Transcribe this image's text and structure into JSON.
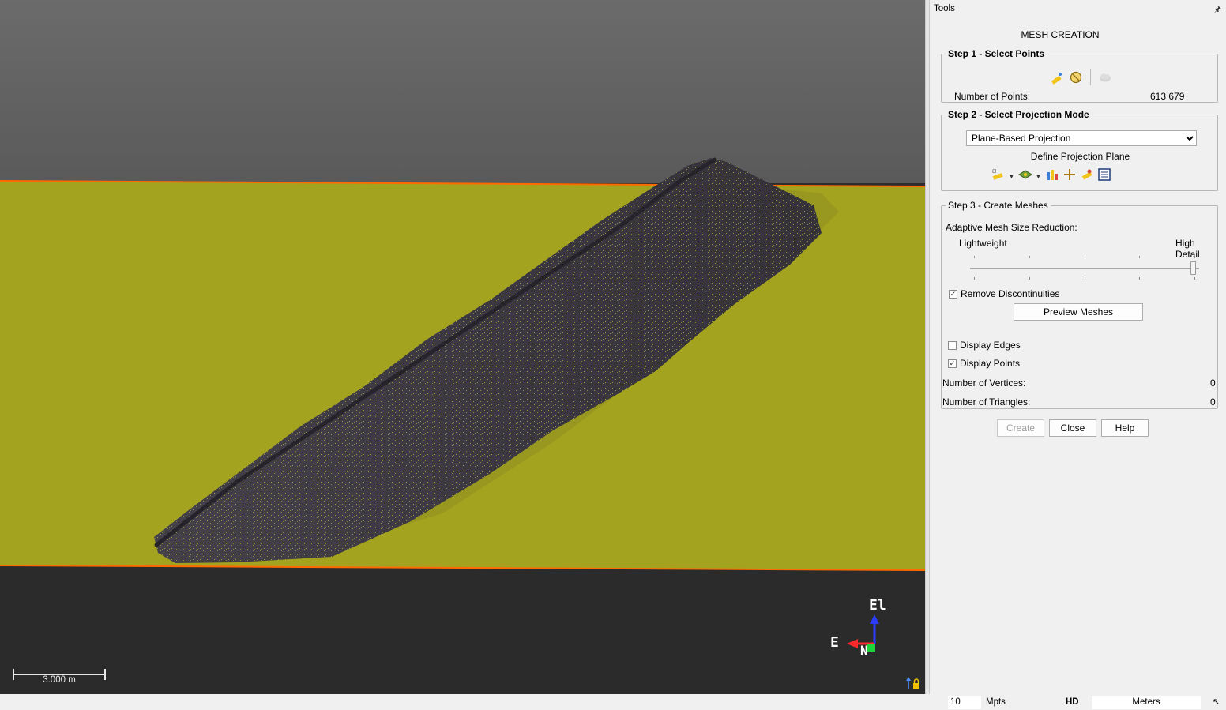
{
  "viewport": {
    "scale_bar_label": "3.000 m",
    "axis_up_label": "El",
    "axis_left_label": "E",
    "axis_front_label": "N",
    "colors": {
      "sky": "#6a6a6a",
      "plane": "#a4a320",
      "plane_edge": "#ff6a00",
      "ground": "#2b2b2b",
      "cloud": "#3f3a42"
    }
  },
  "tools": {
    "title": "Tools",
    "header": "MESH CREATION",
    "step1": {
      "legend": "Step 1 - Select Points",
      "num_points_label": "Number of Points:",
      "num_points_value": "613 679"
    },
    "step2": {
      "legend": "Step 2 - Select Projection Mode",
      "projection_mode": "Plane-Based Projection",
      "define_plane_label": "Define Projection Plane"
    },
    "step3": {
      "legend": "Step 3 - Create Meshes",
      "adaptive_label": "Adaptive Mesh Size Reduction:",
      "slider_min_label": "Lightweight",
      "slider_max_label": "High Detail",
      "slider_value": 1.0,
      "remove_disc_label": "Remove Discontinuities",
      "remove_disc_checked": true,
      "preview_button": "Preview Meshes",
      "display_edges_label": "Display Edges",
      "display_edges_checked": false,
      "display_points_label": "Display Points",
      "display_points_checked": true,
      "vertices_label": "Number of Vertices:",
      "vertices_value": "0",
      "triangles_label": "Number of Triangles:",
      "triangles_value": "0"
    },
    "buttons": {
      "create": "Create",
      "close": "Close",
      "help": "Help"
    }
  },
  "statusbar": {
    "points_value": "10",
    "points_unit": "Mpts",
    "quality": "HD",
    "units": "Meters"
  }
}
